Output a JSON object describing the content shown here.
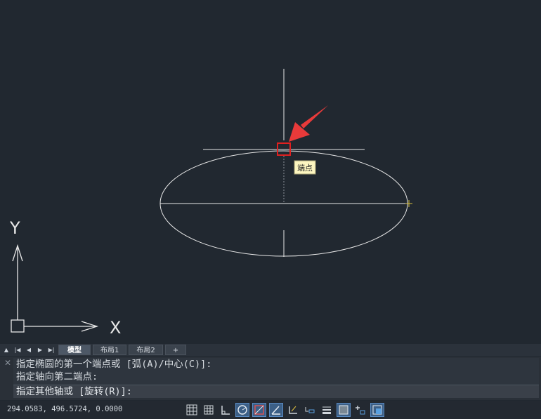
{
  "tooltip": {
    "label": "端点"
  },
  "ucs": {
    "y_label": "Y",
    "x_label": "X"
  },
  "layout_tabs": {
    "items": [
      {
        "label": "模型",
        "active": true
      },
      {
        "label": "布局1",
        "active": false
      },
      {
        "label": "布局2",
        "active": false
      },
      {
        "label": "+",
        "active": false
      }
    ]
  },
  "command": {
    "history": [
      "指定椭圆的第一个端点或 [弧(A)/中心(C)]:",
      "指定轴向第二端点:"
    ],
    "prompt": "指定其他轴或 [旋转(R)]:"
  },
  "status_bar": {
    "coordinates": "294.0583, 496.5724, 0.0000",
    "icons": [
      {
        "name": "model-space-grid-icon",
        "active": false
      },
      {
        "name": "grid-icon",
        "active": false
      },
      {
        "name": "ortho-icon",
        "active": false
      },
      {
        "name": "polar-tracking-icon",
        "active": true
      },
      {
        "name": "object-snap-icon",
        "active": true
      },
      {
        "name": "snap-tracking-icon",
        "active": true
      },
      {
        "name": "dynamic-ucs-icon",
        "active": false
      },
      {
        "name": "dynamic-input-icon",
        "active": false
      },
      {
        "name": "lineweight-icon",
        "active": false
      },
      {
        "name": "transparency-icon",
        "active": true
      },
      {
        "name": "selection-cycling-icon",
        "active": false
      },
      {
        "name": "annotation-scale-icon",
        "active": true
      }
    ]
  },
  "colors": {
    "canvas": "#212830",
    "marker": "#e02020",
    "tooltip_bg": "#fdf6c0",
    "snap_glyph": "#d8c040"
  }
}
